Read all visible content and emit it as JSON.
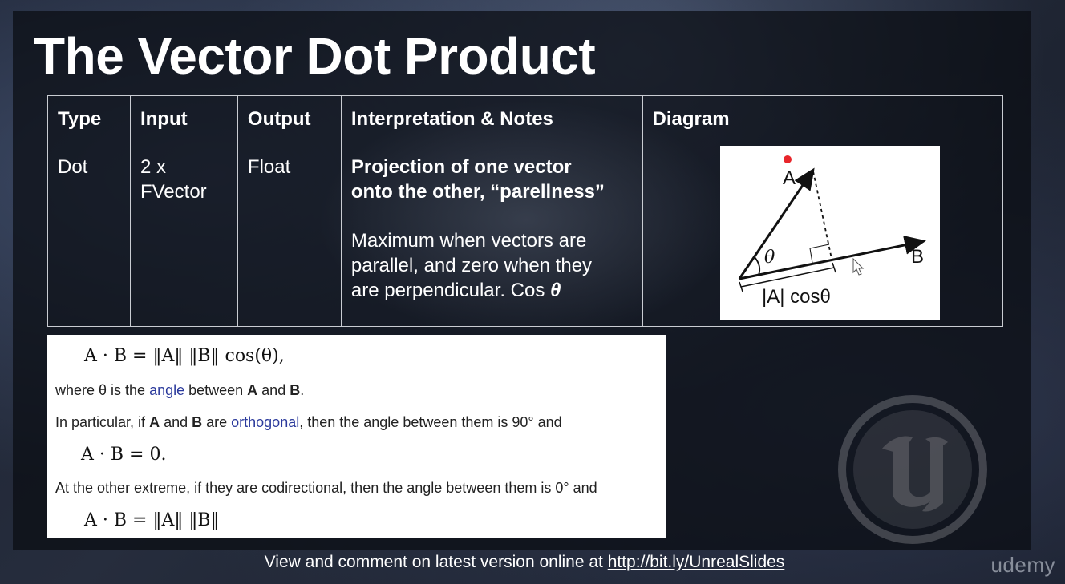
{
  "title": "The Vector Dot Product",
  "table": {
    "headers": [
      "Type",
      "Input",
      "Output",
      "Interpretation & Notes",
      "Diagram"
    ],
    "row": {
      "type": "Dot",
      "input_line1": "2 x",
      "input_line2": "FVector",
      "output": "Float",
      "notes_bold_line1": "Projection of one vector",
      "notes_bold_line2": "onto the other, “parellness”",
      "notes_line1": "Maximum when vectors are",
      "notes_line2": "parallel, and zero when they",
      "notes_line3": "are perpendicular. Cos ",
      "notes_theta": "θ"
    }
  },
  "diagram": {
    "label_a": "A",
    "label_b": "B",
    "label_theta": "θ",
    "label_projection": "|A| cosθ",
    "marker_color": "#e8262b"
  },
  "math": {
    "eq1": "A · B = ‖A‖ ‖B‖ cos(θ),",
    "text1_pre": "where θ is the ",
    "text1_link": "angle",
    "text1_mid": " between ",
    "text1_a": "A",
    "text1_and": " and ",
    "text1_b": "B",
    "text1_end": ".",
    "text2_pre": "In particular, if ",
    "text2_a": "A",
    "text2_and": " and ",
    "text2_b": "B",
    "text2_are": " are ",
    "text2_link": "orthogonal",
    "text2_end": ", then the angle between them is 90° and",
    "eq2": "A · B = 0.",
    "text3": "At the other extreme, if they are codirectional, then the angle between them is 0° and",
    "eq3": "A · B = ‖A‖ ‖B‖"
  },
  "footer": {
    "text": "View and comment on latest version online at ",
    "link": "http://bit.ly/UnrealSlides"
  },
  "brand": "udemy"
}
